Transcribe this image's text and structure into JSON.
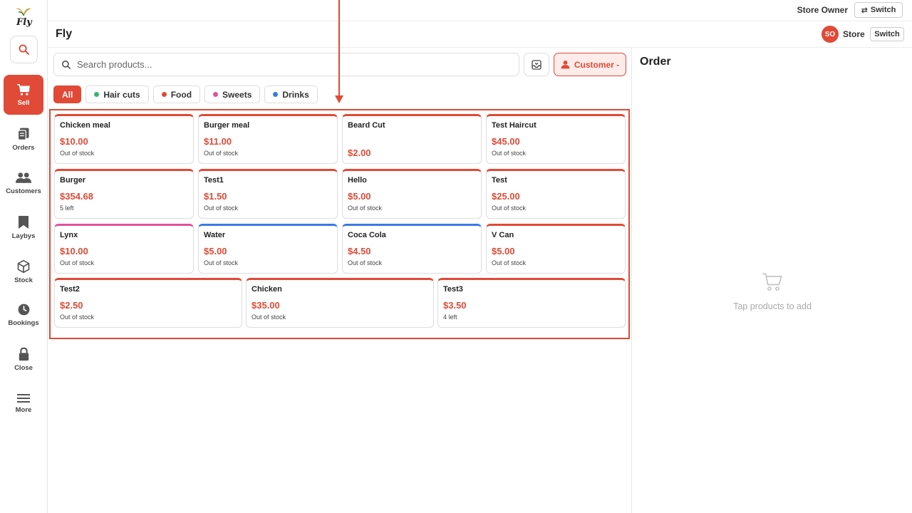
{
  "sidebar": {
    "logo_text": "Fly",
    "items": [
      {
        "label": "Sell",
        "icon": "cart-icon",
        "active": true
      },
      {
        "label": "Orders",
        "icon": "orders-icon"
      },
      {
        "label": "Customers",
        "icon": "customers-icon"
      },
      {
        "label": "Laybys",
        "icon": "bookmark-icon"
      },
      {
        "label": "Stock",
        "icon": "box-icon"
      },
      {
        "label": "Bookings",
        "icon": "clock-icon"
      },
      {
        "label": "Close",
        "icon": "lock-icon"
      },
      {
        "label": "More",
        "icon": "menu-icon"
      }
    ]
  },
  "topbar": {
    "user_role": "Store Owner",
    "switch_label": "Switch"
  },
  "header": {
    "title": "Fly",
    "avatar_initials": "SO",
    "store_label": "Store",
    "switch_label": "Switch"
  },
  "search": {
    "placeholder": "Search products..."
  },
  "customer_button": {
    "label": "Customer -"
  },
  "filters": [
    {
      "label": "All",
      "active": true
    },
    {
      "label": "Hair cuts",
      "color": "#3cb371"
    },
    {
      "label": "Food",
      "color": "#e04a36"
    },
    {
      "label": "Sweets",
      "color": "#e0529c"
    },
    {
      "label": "Drinks",
      "color": "#3b7be0"
    }
  ],
  "products": [
    {
      "name": "Chicken meal",
      "price": "$10.00",
      "stock": "Out of stock",
      "color": "#e04a36"
    },
    {
      "name": "Burger meal",
      "price": "$11.00",
      "stock": "Out of stock",
      "color": "#e04a36"
    },
    {
      "name": "Beard Cut",
      "price": "$2.00",
      "stock": "",
      "color": "#e04a36"
    },
    {
      "name": "Test Haircut",
      "price": "$45.00",
      "stock": "Out of stock",
      "color": "#e04a36"
    },
    {
      "name": "Burger",
      "price": "$354.68",
      "stock": "5 left",
      "color": "#e04a36"
    },
    {
      "name": "Test1",
      "price": "$1.50",
      "stock": "Out of stock",
      "color": "#e04a36"
    },
    {
      "name": "Hello",
      "price": "$5.00",
      "stock": "Out of stock",
      "color": "#e04a36"
    },
    {
      "name": "Test",
      "price": "$25.00",
      "stock": "Out of stock",
      "color": "#e04a36"
    },
    {
      "name": "Lynx",
      "price": "$10.00",
      "stock": "Out of stock",
      "color": "#e0529c"
    },
    {
      "name": "Water",
      "price": "$5.00",
      "stock": "Out of stock",
      "color": "#3b7be0"
    },
    {
      "name": "Coca Cola",
      "price": "$4.50",
      "stock": "Out of stock",
      "color": "#3b7be0"
    },
    {
      "name": "V Can",
      "price": "$5.00",
      "stock": "Out of stock",
      "color": "#e04a36"
    },
    {
      "name": "Test2",
      "price": "$2.50",
      "stock": "Out of stock",
      "color": "#e04a36"
    },
    {
      "name": "Chicken",
      "price": "$35.00",
      "stock": "Out of stock",
      "color": "#e04a36"
    },
    {
      "name": "Test3",
      "price": "$3.50",
      "stock": "4 left",
      "color": "#e04a36"
    }
  ],
  "order": {
    "title": "Order",
    "empty_text": "Tap products to add"
  },
  "colors": {
    "accent": "#e04a36",
    "accent_light": "#fdecea"
  }
}
